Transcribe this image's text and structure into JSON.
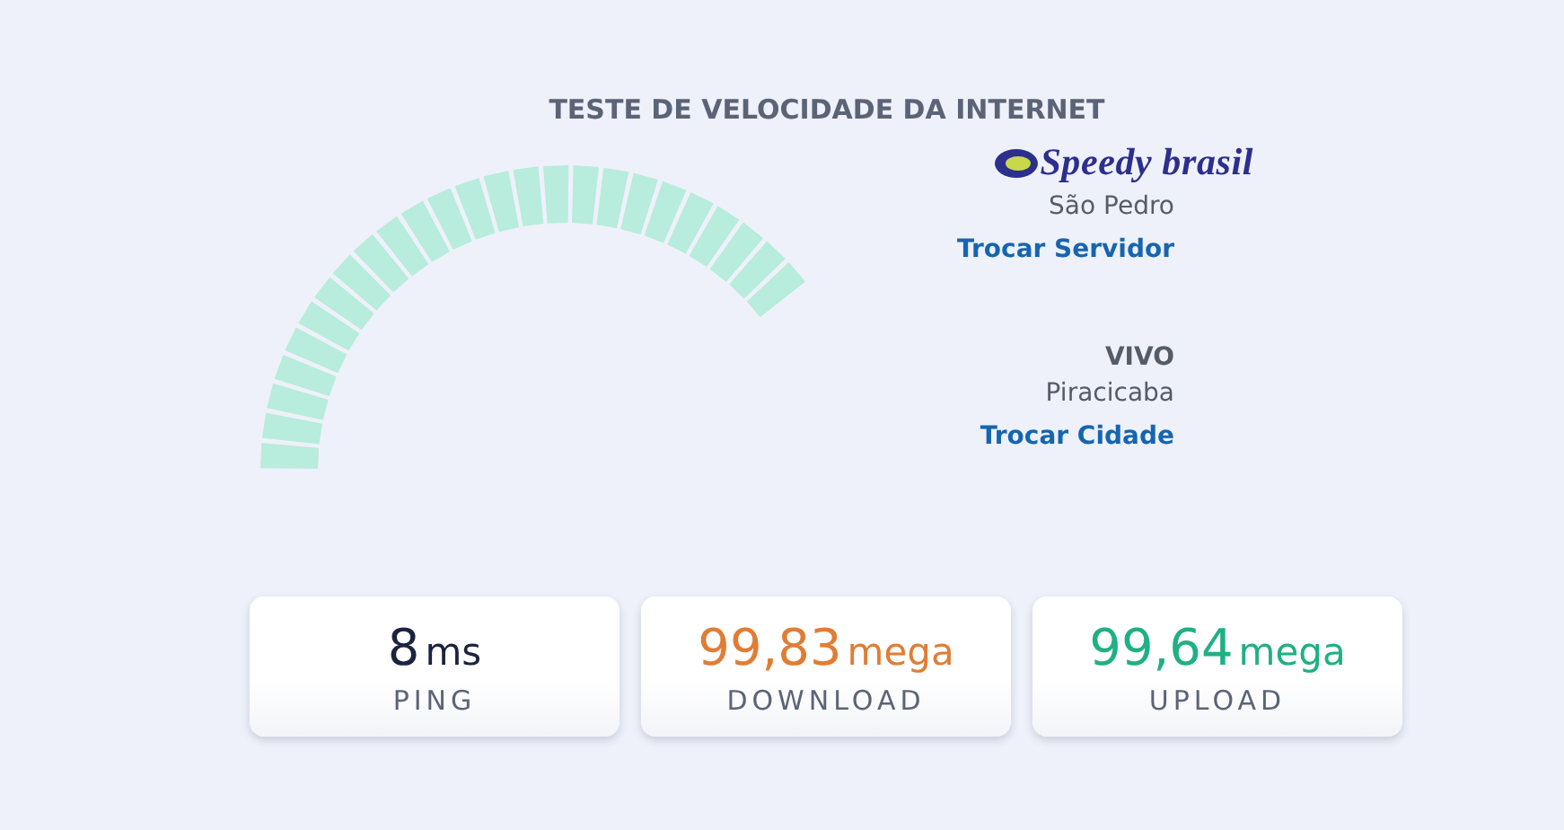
{
  "title": "TESTE DE VELOCIDADE DA INTERNET",
  "server": {
    "logo": "Speedy brasil",
    "city": "São Pedro",
    "action": "Trocar Servidor"
  },
  "provider": {
    "name": "VIVO",
    "city": "Piracicaba",
    "action": "Trocar Cidade"
  },
  "stats": [
    {
      "kind": "ping",
      "value": "8",
      "unit": "ms",
      "label": "PING"
    },
    {
      "kind": "download",
      "value": "99,83",
      "unit": "mega",
      "label": "DOWNLOAD"
    },
    {
      "kind": "upload",
      "value": "99,64",
      "unit": "mega",
      "label": "UPLOAD"
    }
  ]
}
